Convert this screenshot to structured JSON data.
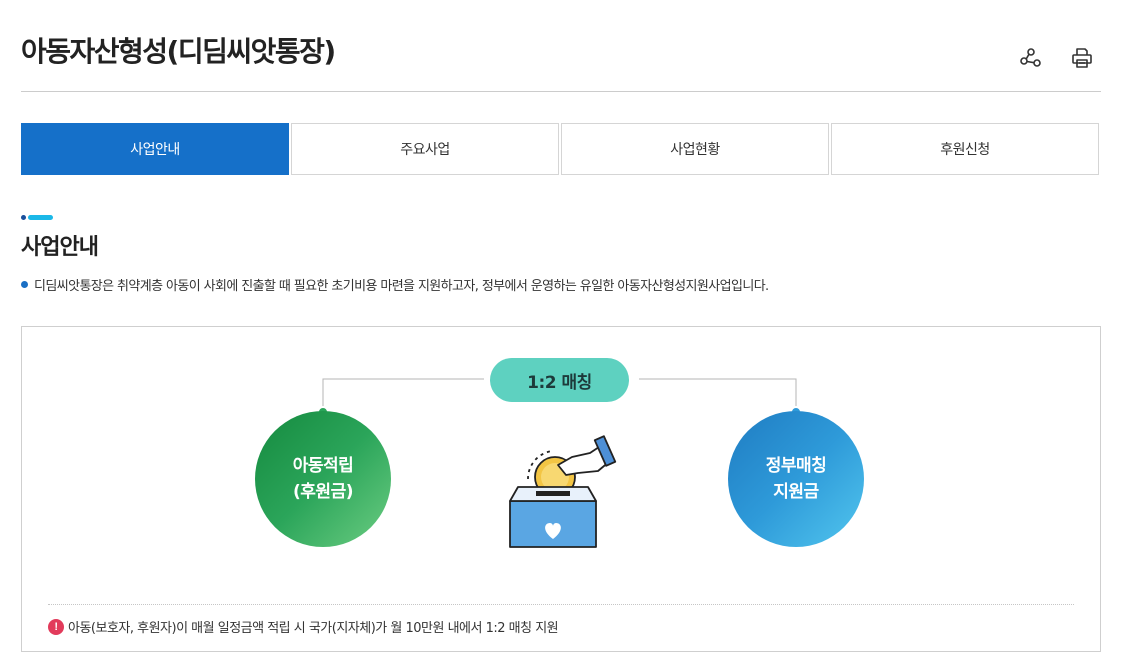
{
  "page": {
    "title": "아동자산형성(디딤씨앗통장)",
    "icons": [
      "share-icon",
      "print-icon"
    ]
  },
  "tabs": [
    {
      "label": "사업안내",
      "active": true
    },
    {
      "label": "주요사업",
      "active": false
    },
    {
      "label": "사업현황",
      "active": false
    },
    {
      "label": "후원신청",
      "active": false
    }
  ],
  "section": {
    "title": "사업안내",
    "description": "디딤씨앗통장은 취약계층 아동이 사회에 진출할 때 필요한 초기비용 마련을 지원하고자, 정부에서 운영하는 유일한 아동자산형성지원사업입니다."
  },
  "diagram": {
    "matching_label": "1:2 매칭",
    "left_circle": {
      "line1": "아동적립",
      "line2": "(후원금)"
    },
    "right_circle": {
      "line1": "정부매칭",
      "line2": "지원금"
    },
    "center_icon": "coin-donation-box-icon",
    "colors": {
      "accent": "#1570c9",
      "pill": "#5ed1c0",
      "green": "#2ba55a",
      "blue": "#2e9ad9",
      "warning": "#e23b5b"
    }
  },
  "note": {
    "icon": "exclamation-icon",
    "symbol": "!",
    "text": "아동(보호자, 후원자)이 매월 일정금액 적립 시 국가(지자체)가 월 10만원 내에서 1:2 매칭 지원"
  }
}
